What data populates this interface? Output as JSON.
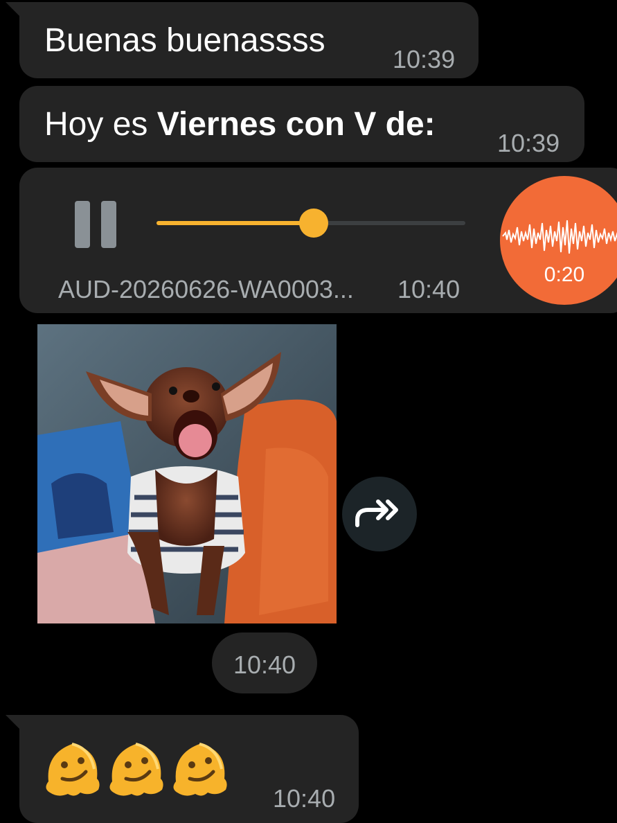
{
  "messages": [
    {
      "text": "Buenas buenassss",
      "time": "10:39"
    },
    {
      "text_plain": "Hoy es ",
      "text_bold": "Viernes con V de:",
      "time": "10:39"
    }
  ],
  "audio": {
    "filename": "AUD-20260626-WA0003...",
    "time": "10:40",
    "duration": "0:20",
    "progress_fraction": 0.51,
    "accent_color": "#f7b22f",
    "avatar_color": "#f26b37"
  },
  "image_message": {
    "icon": "forward-icon",
    "time": "10:40"
  },
  "emoji_message": {
    "emoji_names": [
      "melting-face",
      "melting-face",
      "melting-face"
    ],
    "time": "10:40"
  },
  "colors": {
    "background": "#000000",
    "bubble": "#242424"
  }
}
